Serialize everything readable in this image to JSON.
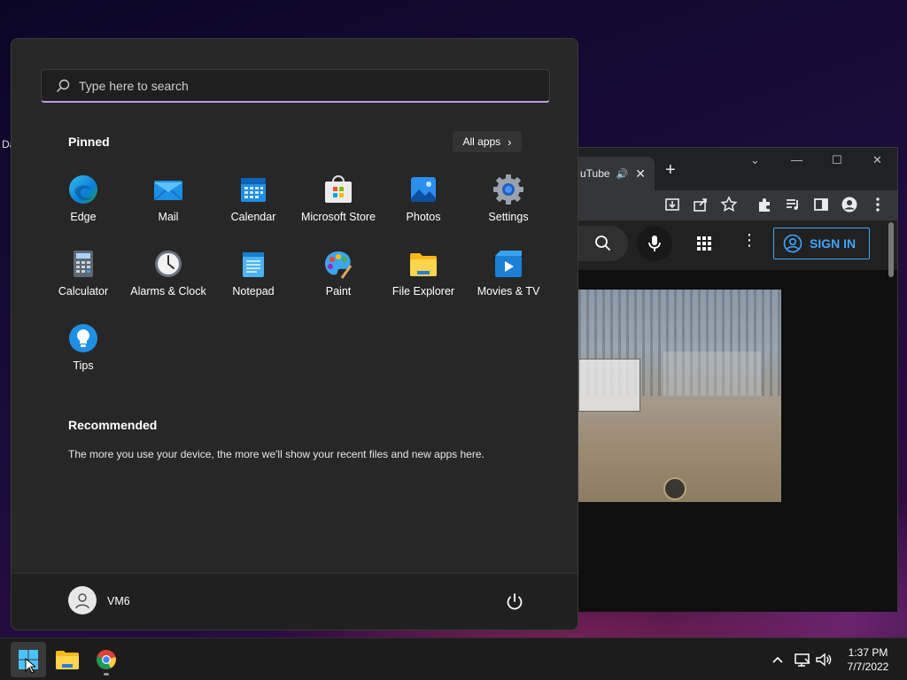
{
  "desktop": {
    "edge_label": "Da"
  },
  "browser": {
    "tab_title": "uTube",
    "tab_audio_icon": "speaker-icon",
    "new_tab_label": "+",
    "signin_label": "SIGN IN"
  },
  "start_menu": {
    "search_placeholder": "Type here to search",
    "pinned_title": "Pinned",
    "all_apps_label": "All apps",
    "pinned_apps": [
      {
        "label": "Edge",
        "icon": "edge-icon"
      },
      {
        "label": "Mail",
        "icon": "mail-icon"
      },
      {
        "label": "Calendar",
        "icon": "calendar-icon"
      },
      {
        "label": "Microsoft Store",
        "icon": "store-icon"
      },
      {
        "label": "Photos",
        "icon": "photos-icon"
      },
      {
        "label": "Settings",
        "icon": "settings-icon"
      },
      {
        "label": "Calculator",
        "icon": "calculator-icon"
      },
      {
        "label": "Alarms & Clock",
        "icon": "clock-icon"
      },
      {
        "label": "Notepad",
        "icon": "notepad-icon"
      },
      {
        "label": "Paint",
        "icon": "paint-icon"
      },
      {
        "label": "File Explorer",
        "icon": "folder-icon"
      },
      {
        "label": "Movies & TV",
        "icon": "movies-icon"
      },
      {
        "label": "Tips",
        "icon": "tips-icon"
      }
    ],
    "recommended_title": "Recommended",
    "recommended_text": "The more you use your device, the more we'll show your recent files and new apps here.",
    "user_name": "VM6"
  },
  "taskbar": {
    "time": "1:37 PM",
    "date": "7/7/2022"
  },
  "colors": {
    "accent": "#c59ae0",
    "youtube_blue": "#3ea6ff",
    "start_bg": "#272727"
  }
}
